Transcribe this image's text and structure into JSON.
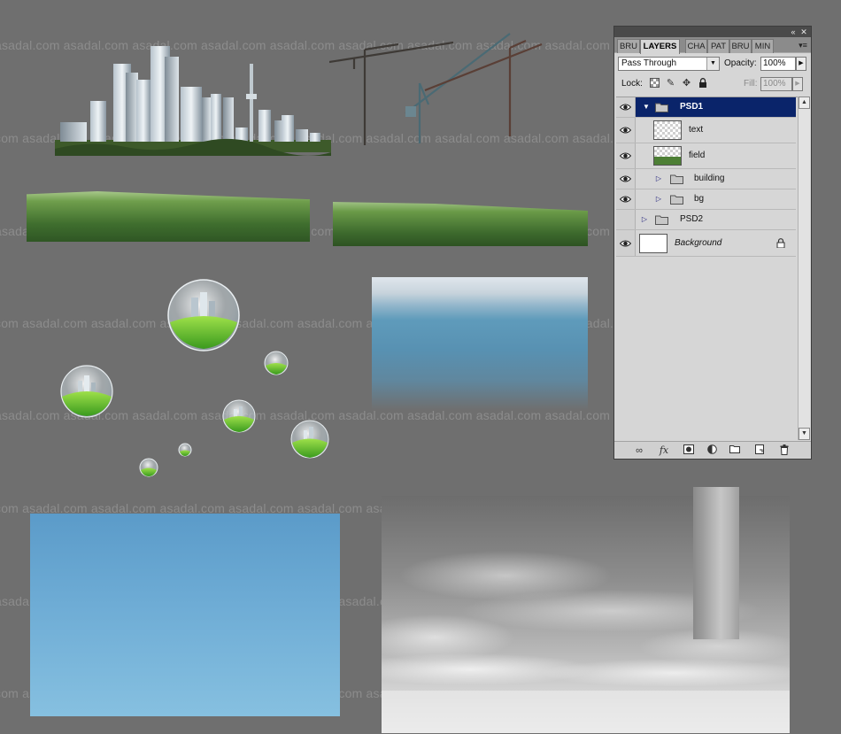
{
  "watermark": {
    "text": "asadal.com",
    "rows": [
      "asadal.com asadal.com asadal.com asadal.com asadal.com asadal.com asadal.com asadal.com asadal.com asadal.com asadal.com",
      "com asadal.com asadal.com asadal.com asadal.com asadal.com asadal.com asadal.com asadal.com asadal.com asadal.com",
      "asadal.com asadal.com asadal.com asadal.com asadal.com asadal.com asadal.com asadal.com asadal.com asadal.com asadal.com",
      "com asadal.com asadal.com asadal.com asadal.com asadal.com asadal.com asadal.com asadal.com asadal.com asadal.com",
      "asadal.com asadal.com asadal.com asadal.com asadal.com asadal.com asadal.com asadal.com asadal.com asadal.com asadal.com",
      "com asadal.com asadal.com asadal.com asadal.com asadal.com asadal.com asadal.com asadal.com asadal.com asadal.com",
      "asadal.com asadal.com asadal.com asadal.com asadal.com asadal.com asadal.com asadal.com asadal.com asadal.com asadal.com",
      "com asadal.com asadal.com asadal.com asadal.com asadal.com asadal.com asadal.com asadal.com asadal.com asadal.com"
    ]
  },
  "canvas": {
    "background": "#6f6f6f",
    "assets": [
      {
        "name": "city-skyline-image",
        "icon": "building-image"
      },
      {
        "name": "cranes-image",
        "icon": "crane-image"
      },
      {
        "name": "grass-field-image",
        "icon": "grass-image"
      },
      {
        "name": "sky-gradient-image",
        "icon": "sky-image"
      },
      {
        "name": "glass-bubbles-image",
        "icon": "bubble-image"
      },
      {
        "name": "clouds-image",
        "icon": "cloud-image"
      }
    ]
  },
  "layers_panel": {
    "titlebar": {
      "collapse_icon": "double-chevron-left-icon",
      "close_icon": "close-icon"
    },
    "tabs": [
      {
        "label": "BRU",
        "active": false
      },
      {
        "label": "LAYERS",
        "active": true
      },
      {
        "label": "CHA",
        "active": false
      },
      {
        "label": "PAT",
        "active": false
      },
      {
        "label": "BRU",
        "active": false
      },
      {
        "label": "MIN",
        "active": false
      }
    ],
    "blend_mode": "Pass Through",
    "opacity_label": "Opacity:",
    "opacity_value": "100%",
    "lock_label": "Lock:",
    "lock_icons": [
      "lock-transparent-icon",
      "lock-brush-icon",
      "lock-move-icon",
      "lock-all-icon"
    ],
    "fill_label": "Fill:",
    "fill_value": "100%",
    "layers": [
      {
        "name": "PSD1",
        "type": "group",
        "visible": true,
        "expanded": true,
        "selected": true,
        "indent": 0
      },
      {
        "name": "text",
        "type": "layer",
        "visible": true,
        "thumb": "checker",
        "indent": 1
      },
      {
        "name": "field",
        "type": "layer",
        "visible": true,
        "thumb": "field",
        "indent": 1
      },
      {
        "name": "building",
        "type": "group",
        "visible": true,
        "expanded": false,
        "indent": 1
      },
      {
        "name": "bg",
        "type": "group",
        "visible": true,
        "expanded": false,
        "indent": 1
      },
      {
        "name": "PSD2",
        "type": "group",
        "visible": false,
        "expanded": false,
        "indent": 0
      },
      {
        "name": "Background",
        "type": "background",
        "visible": true,
        "thumb": "white",
        "locked": true,
        "indent": 0
      }
    ],
    "footer_icons": [
      "link-icon",
      "fx-icon",
      "mask-icon",
      "adjustment-icon",
      "new-group-icon",
      "new-layer-icon",
      "trash-icon"
    ]
  }
}
